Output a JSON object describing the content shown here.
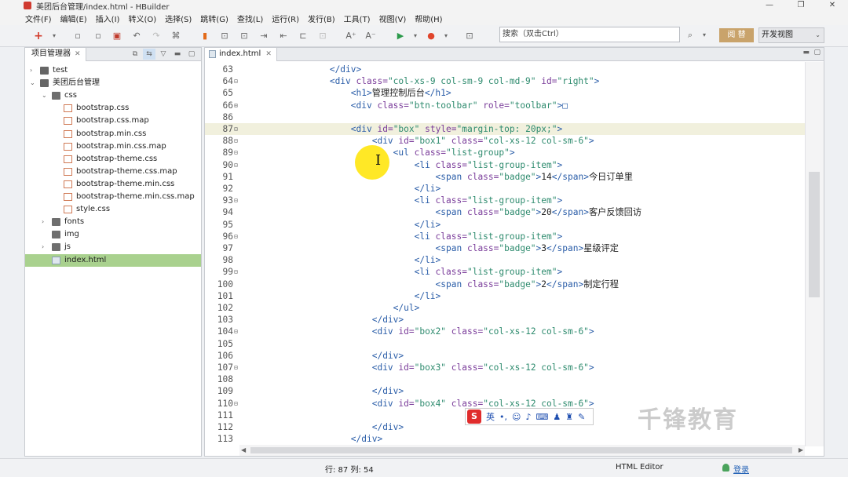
{
  "window": {
    "title": "美团后台管理/index.html  -  HBuilder",
    "controls": [
      "—",
      "❐",
      "✕"
    ]
  },
  "menu": [
    "文件(F)",
    "编辑(E)",
    "插入(I)",
    "转义(O)",
    "选择(S)",
    "跳转(G)",
    "查找(L)",
    "运行(R)",
    "发行(B)",
    "工具(T)",
    "视图(V)",
    "帮助(H)"
  ],
  "toolbar": {
    "search_placeholder": "搜索（双击Ctrl）",
    "login_button": "阅 替",
    "view_mode": "开发视图"
  },
  "project_panel": {
    "tab_label": "项目管理器",
    "tree": [
      {
        "label": "test",
        "depth": 0,
        "arrow": "›",
        "icon": "proj"
      },
      {
        "label": "美团后台管理",
        "depth": 0,
        "arrow": "⌄",
        "icon": "proj"
      },
      {
        "label": "css",
        "depth": 1,
        "arrow": "⌄",
        "icon": "folder"
      },
      {
        "label": "bootstrap.css",
        "depth": 2,
        "arrow": "",
        "icon": "file"
      },
      {
        "label": "bootstrap.css.map",
        "depth": 2,
        "arrow": "",
        "icon": "file"
      },
      {
        "label": "bootstrap.min.css",
        "depth": 2,
        "arrow": "",
        "icon": "file"
      },
      {
        "label": "bootstrap.min.css.map",
        "depth": 2,
        "arrow": "",
        "icon": "file"
      },
      {
        "label": "bootstrap-theme.css",
        "depth": 2,
        "arrow": "",
        "icon": "file"
      },
      {
        "label": "bootstrap-theme.css.map",
        "depth": 2,
        "arrow": "",
        "icon": "file"
      },
      {
        "label": "bootstrap-theme.min.css",
        "depth": 2,
        "arrow": "",
        "icon": "file"
      },
      {
        "label": "bootstrap-theme.min.css.map",
        "depth": 2,
        "arrow": "",
        "icon": "file"
      },
      {
        "label": "style.css",
        "depth": 2,
        "arrow": "",
        "icon": "file"
      },
      {
        "label": "fonts",
        "depth": 1,
        "arrow": "›",
        "icon": "folder"
      },
      {
        "label": "img",
        "depth": 1,
        "arrow": "",
        "icon": "folder"
      },
      {
        "label": "js",
        "depth": 1,
        "arrow": "›",
        "icon": "folder"
      },
      {
        "label": "index.html",
        "depth": 1,
        "arrow": "",
        "icon": "html",
        "selected": true
      }
    ]
  },
  "editor": {
    "tab_label": "index.html",
    "lines": [
      {
        "n": "63",
        "fold": "",
        "code": [
          [
            "            ",
            "x2"
          ],
          [
            "</div>",
            "t"
          ]
        ]
      },
      {
        "n": "64",
        "fold": "⊟",
        "code": [
          [
            "            ",
            "x2"
          ],
          [
            "<div ",
            "t"
          ],
          [
            "class=",
            "a"
          ],
          [
            "\"col-xs-9 col-sm-9 col-md-9\"",
            "v"
          ],
          [
            " id=",
            "a"
          ],
          [
            "\"right\"",
            "v"
          ],
          [
            ">",
            "t"
          ]
        ]
      },
      {
        "n": "65",
        "fold": "",
        "code": [
          [
            "                ",
            "x2"
          ],
          [
            "<h1>",
            "t"
          ],
          [
            "管理控制后台",
            "x2"
          ],
          [
            "</h1>",
            "t"
          ]
        ]
      },
      {
        "n": "66",
        "fold": "⊞",
        "code": [
          [
            "                ",
            "x2"
          ],
          [
            "<div ",
            "t"
          ],
          [
            "class=",
            "a"
          ],
          [
            "\"btn-toolbar\"",
            "v"
          ],
          [
            " role=",
            "a"
          ],
          [
            "\"toolbar\"",
            "v"
          ],
          [
            ">□",
            "t"
          ]
        ]
      },
      {
        "n": "86",
        "fold": "",
        "code": [
          [
            "",
            "x2"
          ]
        ]
      },
      {
        "n": "87",
        "fold": "⊟",
        "hl": true,
        "code": [
          [
            "                ",
            "x2"
          ],
          [
            "<div ",
            "t"
          ],
          [
            "id=",
            "a"
          ],
          [
            "\"box\"",
            "v"
          ],
          [
            " style=",
            "a"
          ],
          [
            "\"margin-top: 20px;\"",
            "v"
          ],
          [
            ">",
            "t"
          ]
        ]
      },
      {
        "n": "88",
        "fold": "⊟",
        "code": [
          [
            "                    ",
            "x2"
          ],
          [
            "<div ",
            "t"
          ],
          [
            "id=",
            "a"
          ],
          [
            "\"box1\"",
            "v"
          ],
          [
            " class=",
            "a"
          ],
          [
            "\"col-xs-12 col-sm-6\"",
            "v"
          ],
          [
            ">",
            "t"
          ]
        ]
      },
      {
        "n": "89",
        "fold": "⊟",
        "code": [
          [
            "                        ",
            "x2"
          ],
          [
            "<ul ",
            "t"
          ],
          [
            "class=",
            "a"
          ],
          [
            "\"list-group\"",
            "v"
          ],
          [
            ">",
            "t"
          ]
        ]
      },
      {
        "n": "90",
        "fold": "⊟",
        "code": [
          [
            "                            ",
            "x2"
          ],
          [
            "<li ",
            "t"
          ],
          [
            "class=",
            "a"
          ],
          [
            "\"list-group-item\"",
            "v"
          ],
          [
            ">",
            "t"
          ]
        ]
      },
      {
        "n": "91",
        "fold": "",
        "code": [
          [
            "                                ",
            "x2"
          ],
          [
            "<span ",
            "t"
          ],
          [
            "class=",
            "a"
          ],
          [
            "\"badge\"",
            "v"
          ],
          [
            ">",
            "t"
          ],
          [
            "14",
            "x2"
          ],
          [
            "</span>",
            "t"
          ],
          [
            "今日订单里",
            "x2"
          ]
        ]
      },
      {
        "n": "92",
        "fold": "",
        "code": [
          [
            "                            ",
            "x2"
          ],
          [
            "</li>",
            "t"
          ]
        ]
      },
      {
        "n": "93",
        "fold": "⊟",
        "code": [
          [
            "                            ",
            "x2"
          ],
          [
            "<li ",
            "t"
          ],
          [
            "class=",
            "a"
          ],
          [
            "\"list-group-item\"",
            "v"
          ],
          [
            ">",
            "t"
          ]
        ]
      },
      {
        "n": "94",
        "fold": "",
        "code": [
          [
            "                                ",
            "x2"
          ],
          [
            "<span ",
            "t"
          ],
          [
            "class=",
            "a"
          ],
          [
            "\"badge\"",
            "v"
          ],
          [
            ">",
            "t"
          ],
          [
            "20",
            "x2"
          ],
          [
            "</span>",
            "t"
          ],
          [
            "客户反馈回访",
            "x2"
          ]
        ]
      },
      {
        "n": "95",
        "fold": "",
        "code": [
          [
            "                            ",
            "x2"
          ],
          [
            "</li>",
            "t"
          ]
        ]
      },
      {
        "n": "96",
        "fold": "⊟",
        "code": [
          [
            "                            ",
            "x2"
          ],
          [
            "<li ",
            "t"
          ],
          [
            "class=",
            "a"
          ],
          [
            "\"list-group-item\"",
            "v"
          ],
          [
            ">",
            "t"
          ]
        ]
      },
      {
        "n": "97",
        "fold": "",
        "code": [
          [
            "                                ",
            "x2"
          ],
          [
            "<span ",
            "t"
          ],
          [
            "class=",
            "a"
          ],
          [
            "\"badge\"",
            "v"
          ],
          [
            ">",
            "t"
          ],
          [
            "3",
            "x2"
          ],
          [
            "</span>",
            "t"
          ],
          [
            "星级评定",
            "x2"
          ]
        ]
      },
      {
        "n": "98",
        "fold": "",
        "code": [
          [
            "                            ",
            "x2"
          ],
          [
            "</li>",
            "t"
          ]
        ]
      },
      {
        "n": "99",
        "fold": "⊟",
        "code": [
          [
            "                            ",
            "x2"
          ],
          [
            "<li ",
            "t"
          ],
          [
            "class=",
            "a"
          ],
          [
            "\"list-group-item\"",
            "v"
          ],
          [
            ">",
            "t"
          ]
        ]
      },
      {
        "n": "100",
        "fold": "",
        "code": [
          [
            "                                ",
            "x2"
          ],
          [
            "<span ",
            "t"
          ],
          [
            "class=",
            "a"
          ],
          [
            "\"badge\"",
            "v"
          ],
          [
            ">",
            "t"
          ],
          [
            "2",
            "x2"
          ],
          [
            "</span>",
            "t"
          ],
          [
            "制定行程",
            "x2"
          ]
        ]
      },
      {
        "n": "101",
        "fold": "",
        "code": [
          [
            "                            ",
            "x2"
          ],
          [
            "</li>",
            "t"
          ]
        ]
      },
      {
        "n": "102",
        "fold": "",
        "code": [
          [
            "                        ",
            "x2"
          ],
          [
            "</ul>",
            "t"
          ]
        ]
      },
      {
        "n": "103",
        "fold": "",
        "code": [
          [
            "                    ",
            "x2"
          ],
          [
            "</div>",
            "t"
          ]
        ]
      },
      {
        "n": "104",
        "fold": "⊟",
        "code": [
          [
            "                    ",
            "x2"
          ],
          [
            "<div ",
            "t"
          ],
          [
            "id=",
            "a"
          ],
          [
            "\"box2\"",
            "v"
          ],
          [
            " class=",
            "a"
          ],
          [
            "\"col-xs-12 col-sm-6\"",
            "v"
          ],
          [
            ">",
            "t"
          ]
        ]
      },
      {
        "n": "105",
        "fold": "",
        "code": [
          [
            "",
            "x2"
          ]
        ]
      },
      {
        "n": "106",
        "fold": "",
        "code": [
          [
            "                    ",
            "x2"
          ],
          [
            "</div>",
            "t"
          ]
        ]
      },
      {
        "n": "107",
        "fold": "⊟",
        "code": [
          [
            "                    ",
            "x2"
          ],
          [
            "<div ",
            "t"
          ],
          [
            "id=",
            "a"
          ],
          [
            "\"box3\"",
            "v"
          ],
          [
            " class=",
            "a"
          ],
          [
            "\"col-xs-12 col-sm-6\"",
            "v"
          ],
          [
            ">",
            "t"
          ]
        ]
      },
      {
        "n": "108",
        "fold": "",
        "code": [
          [
            "",
            "x2"
          ]
        ]
      },
      {
        "n": "109",
        "fold": "",
        "code": [
          [
            "                    ",
            "x2"
          ],
          [
            "</div>",
            "t"
          ]
        ]
      },
      {
        "n": "110",
        "fold": "⊟",
        "code": [
          [
            "                    ",
            "x2"
          ],
          [
            "<div ",
            "t"
          ],
          [
            "id=",
            "a"
          ],
          [
            "\"box4\"",
            "v"
          ],
          [
            " class=",
            "a"
          ],
          [
            "\"col-xs-12 col-sm-6\"",
            "v"
          ],
          [
            ">",
            "t"
          ]
        ]
      },
      {
        "n": "111",
        "fold": "",
        "code": [
          [
            "",
            "x2"
          ]
        ]
      },
      {
        "n": "112",
        "fold": "",
        "code": [
          [
            "                    ",
            "x2"
          ],
          [
            "</div>",
            "t"
          ]
        ]
      },
      {
        "n": "113",
        "fold": "",
        "code": [
          [
            "                ",
            "x2"
          ],
          [
            "</div>",
            "t"
          ]
        ]
      }
    ]
  },
  "status": {
    "position": "行: 87 列: 54",
    "editor_type": "HTML Editor",
    "login": "登录"
  },
  "ime": {
    "logo": "S",
    "mode": "英"
  },
  "watermark": "千锋教育",
  "colors": {
    "tag": "#2a5da8",
    "attr": "#7a3c9a",
    "value": "#2e8b6e",
    "highlight": "#f1f0dd",
    "selected": "#a9d18e",
    "login": "#c9a36b"
  }
}
